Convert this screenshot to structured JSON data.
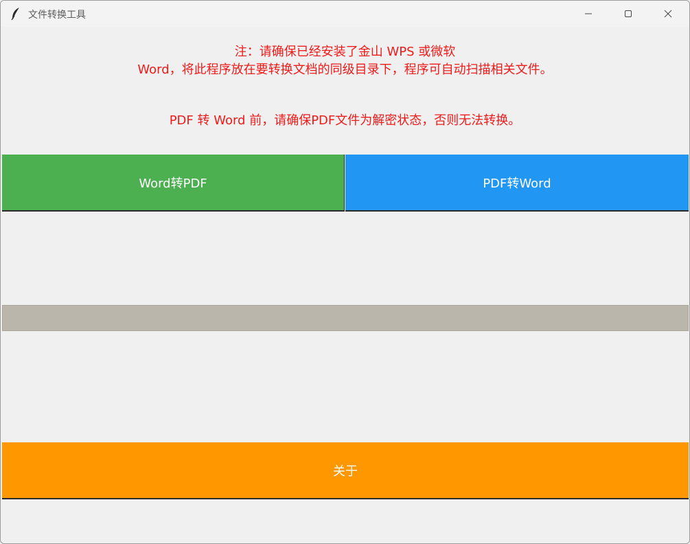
{
  "window": {
    "title": "文件转换工具",
    "icon": "feather-icon",
    "controls": [
      "minimize-icon",
      "maximize-icon",
      "close-icon"
    ]
  },
  "notices": {
    "line1": "注：请确保已经安装了金山 WPS 或微软",
    "line2": "Word，将此程序放在要转换文档的同级目录下，程序可自动扫描相关文件。",
    "line3": "PDF 转 Word 前，请确保PDF文件为解密状态，否则无法转换。",
    "color": "#ee1b1b"
  },
  "buttons": {
    "word_to_pdf": {
      "label": "Word转PDF",
      "color": "#4caf50"
    },
    "pdf_to_word": {
      "label": "PDF转Word",
      "color": "#2196f3"
    },
    "about": {
      "label": "关于",
      "color": "#ff9800"
    }
  },
  "progress": {
    "value": 0,
    "track_color": "#bab6ab"
  }
}
